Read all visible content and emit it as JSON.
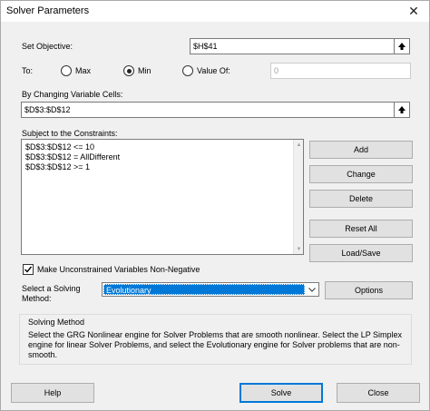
{
  "window": {
    "title": "Solver Parameters"
  },
  "objective": {
    "label": "Set Objective:",
    "value": "$H$41"
  },
  "to": {
    "label": "To:",
    "options": [
      {
        "label": "Max",
        "selected": false
      },
      {
        "label": "Min",
        "selected": true
      },
      {
        "label": "Value Of:",
        "selected": false
      }
    ],
    "value_of": "0"
  },
  "changing_cells": {
    "label": "By Changing Variable Cells:",
    "value": "$D$3:$D$12"
  },
  "constraints": {
    "label": "Subject to the Constraints:",
    "items": [
      "$D$3:$D$12 <= 10",
      "$D$3:$D$12 = AllDifferent",
      "$D$3:$D$12 >= 1"
    ],
    "buttons": {
      "add": "Add",
      "change": "Change",
      "delete": "Delete",
      "reset": "Reset All",
      "load_save": "Load/Save"
    }
  },
  "nonnegative": {
    "label": "Make Unconstrained Variables Non-Negative",
    "checked": true
  },
  "method": {
    "label_line1": "Select a Solving",
    "label_line2": "Method:",
    "value": "Evolutionary",
    "options_button": "Options"
  },
  "solving_method": {
    "title": "Solving Method",
    "description": "Select the GRG Nonlinear engine for Solver Problems that are smooth nonlinear. Select the LP Simplex engine for linear Solver Problems, and select the Evolutionary engine for Solver problems that are non-smooth."
  },
  "footer": {
    "help": "Help",
    "solve": "Solve",
    "close": "Close"
  },
  "colors": {
    "accent": "#0078d7",
    "dialog_bg": "#f0f0f0"
  }
}
